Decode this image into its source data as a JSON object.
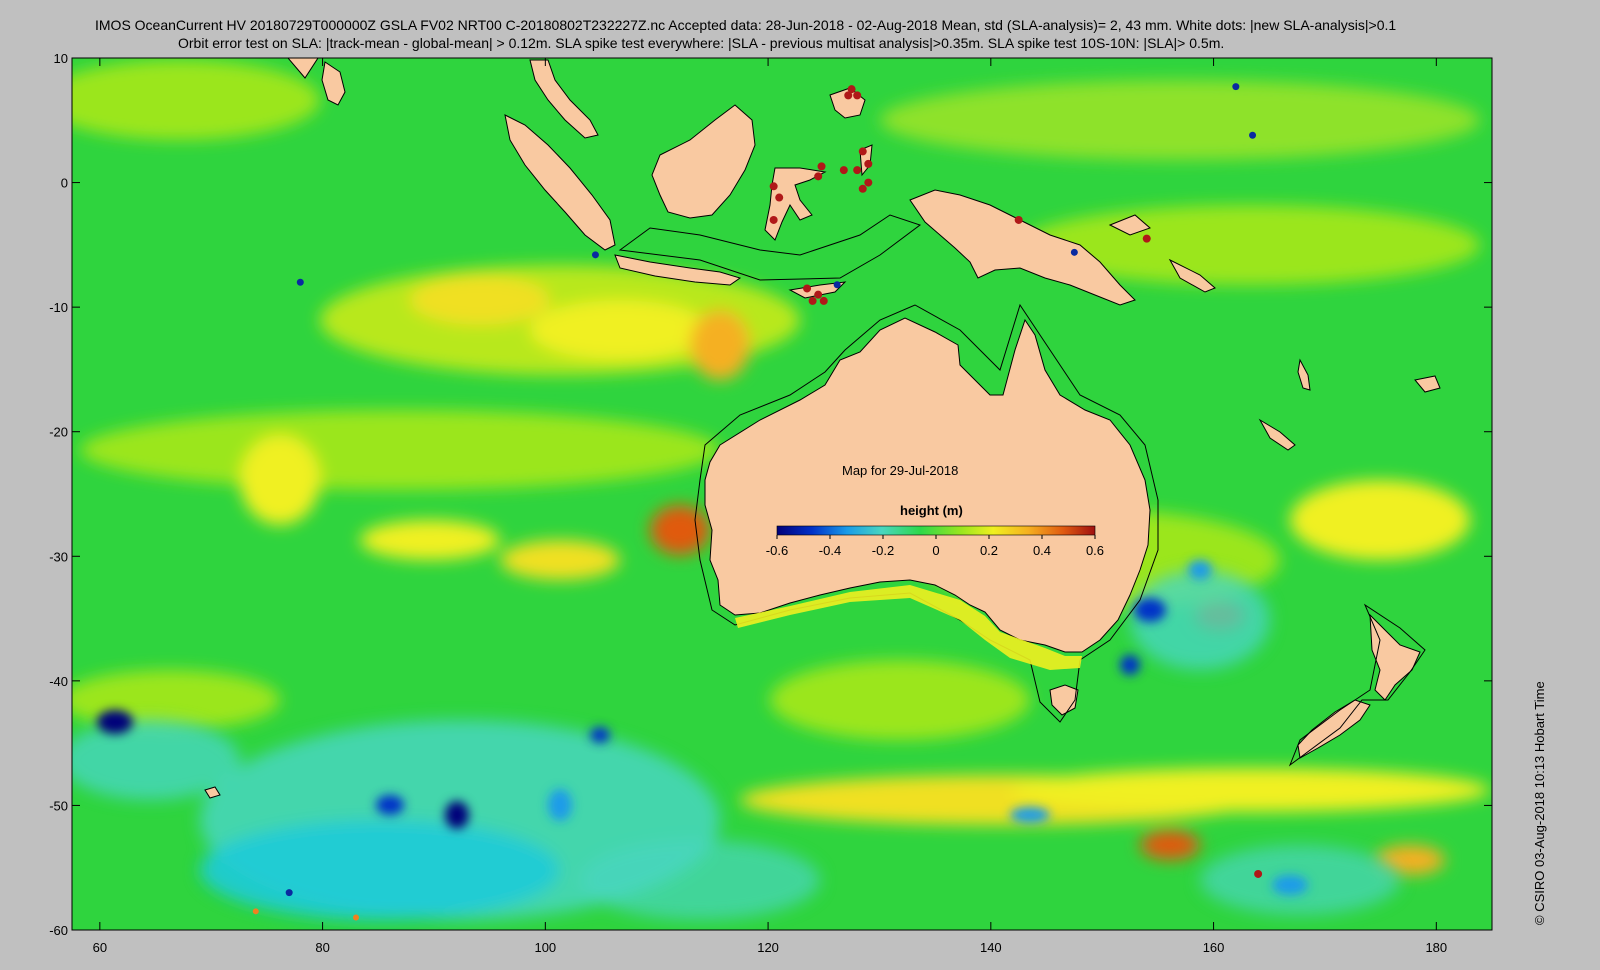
{
  "title": {
    "line1": "IMOS OceanCurrent HV 20180729T000000Z GSLA FV02 NRT00 C-20180802T232227Z.nc  Accepted data: 28-Jun-2018 - 02-Aug-2018 Mean, std (SLA-analysis)= 2, 43 mm. White dots: |new SLA-analysis|>0.1",
    "line2": "Orbit error test on SLA: |track-mean  - global-mean| > 0.12m.  SLA spike test everywhere: |SLA - previous multisat analysis|>0.35m. SLA spike test 10S-10N: |SLA|> 0.5m."
  },
  "map": {
    "lon_range": [
      57.5,
      185
    ],
    "lat_range": [
      -60,
      10
    ],
    "x_ticks": [
      "60",
      "80",
      "100",
      "120",
      "140",
      "160",
      "180"
    ],
    "y_ticks": [
      "10",
      "0",
      "-10",
      "-20",
      "-30",
      "-40",
      "-50",
      "-60"
    ],
    "inset_title": "Map for 29-Jul-2018",
    "colorbar": {
      "label": "height (m)",
      "ticks": [
        "-0.6",
        "-0.4",
        "-0.2",
        "0",
        "0.2",
        "0.4",
        "0.6"
      ],
      "colors": [
        "#00007a",
        "#0030c8",
        "#1a9be8",
        "#49d6c0",
        "#2ed84a",
        "#9be61f",
        "#f0f020",
        "#f5b020",
        "#e05a10",
        "#a01010"
      ]
    },
    "land_color": "#f9c9a1",
    "ocean_base_color": "#2fd43e",
    "credit": "© CSIRO 03-Aug-2018 10:13 Hobart Time"
  }
}
